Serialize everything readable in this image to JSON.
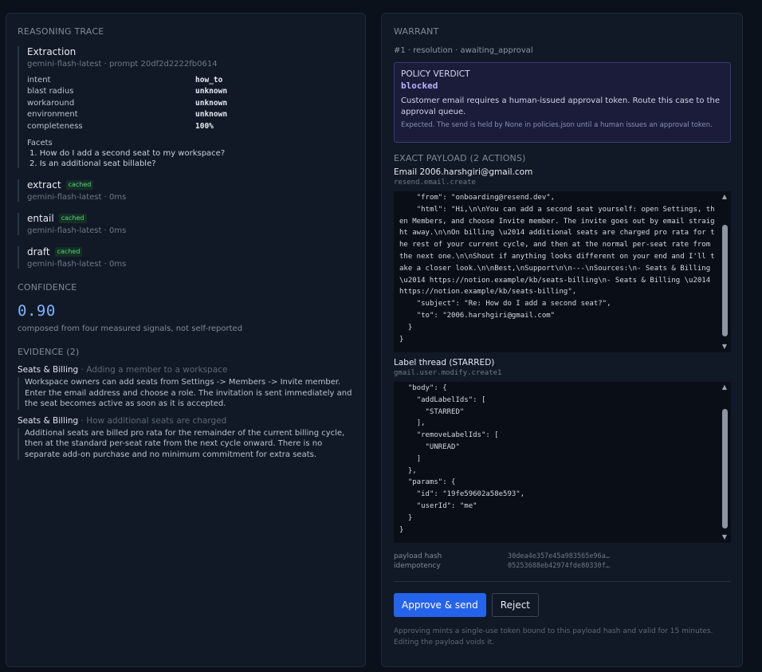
{
  "trace": {
    "title": "REASONING TRACE",
    "extraction": {
      "title": "Extraction",
      "sub": "gemini-flash-latest · prompt 20df2d2222fb0614",
      "fields": [
        {
          "k": "intent",
          "v": "how_to"
        },
        {
          "k": "blast radius",
          "v": "unknown"
        },
        {
          "k": "workaround",
          "v": "unknown"
        },
        {
          "k": "environment",
          "v": "unknown"
        },
        {
          "k": "completeness",
          "v": "100%"
        }
      ],
      "facets_label": "Facets",
      "facets": [
        "1. How do I add a second seat to my workspace?",
        "2. Is an additional seat billable?"
      ]
    },
    "steps": [
      {
        "title": "extract",
        "badge": "cached",
        "sub": "gemini-flash-latest · 0ms"
      },
      {
        "title": "entail",
        "badge": "cached",
        "sub": "gemini-flash-latest · 0ms"
      },
      {
        "title": "draft",
        "badge": "cached",
        "sub": "gemini-flash-latest · 0ms"
      }
    ]
  },
  "confidence": {
    "title": "CONFIDENCE",
    "value": "0.90",
    "sub": "composed from four measured signals, not self-reported"
  },
  "evidence": {
    "title": "EVIDENCE (2)",
    "items": [
      {
        "source": "Seats & Billing",
        "topic": " · Adding a member to a workspace",
        "body": "Workspace owners can add seats from Settings -> Members -> Invite member. Enter the email address and choose a role. The invitation is sent immediately and the seat becomes active as soon as it is accepted."
      },
      {
        "source": "Seats & Billing",
        "topic": " · How additional seats are charged",
        "body": "Additional seats are billed pro rata for the remainder of the current billing cycle, then at the standard per-seat rate from the next cycle onward. There is no separate add-on purchase and no minimum commitment for extra seats."
      }
    ]
  },
  "warrant": {
    "title": "WARRANT",
    "sub": "#1 · resolution · awaiting_approval",
    "verdict": {
      "heading": "POLICY VERDICT",
      "value": "blocked",
      "description": "Customer email requires a human-issued approval token. Route this case to the approval queue.",
      "expected": "Expected. The send is held by None in policies.json until a human issues an approval token."
    },
    "payload_title": "EXACT PAYLOAD (2 ACTIONS)",
    "actions": [
      {
        "title": "Email 2006.harshgiri@gmail.com",
        "sub": "resend.email.create",
        "code": "    \"from\": \"onboarding@resend.dev\",\n    \"html\": \"Hi,\\n\\nYou can add a second seat yourself: open Settings, then Members, and choose Invite member. The invite goes out by email straight away.\\n\\nOn billing \\u2014 additional seats are charged pro rata for the rest of your current cycle, and then at the normal per-seat rate from the next one.\\n\\nShout if anything looks different on your end and I'll take a closer look.\\n\\nBest,\\nSupport\\n\\n---\\nSources:\\n- Seats & Billing \\u2014 https://notion.example/kb/seats-billing\\n- Seats & Billing \\u2014 https://notion.example/kb/seats-billing\",\n    \"subject\": \"Re: How do I add a second seat?\",\n    \"to\": \"2006.harshgiri@gmail.com\"\n  }\n}"
      },
      {
        "title": "Label thread (STARRED)",
        "sub": "gmail.user.modify.create1",
        "code": "  \"body\": {\n    \"addLabelIds\": [\n      \"STARRED\"\n    ],\n    \"removeLabelIds\": [\n      \"UNREAD\"\n    ]\n  },\n  \"params\": {\n    \"id\": \"19fe59602a58e593\",\n    \"userId\": \"me\"\n  }\n}"
      }
    ],
    "meta": [
      {
        "k": "payload hash",
        "v": "30dea4e357e45a983565e96a…"
      },
      {
        "k": "idempotency",
        "v": "05253688eb42974fde80330f…"
      }
    ],
    "approve_label": "Approve & send",
    "reject_label": "Reject",
    "footnote": "Approving mints a single-use token bound to this payload hash and valid for 15 minutes. Editing the payload voids it."
  }
}
